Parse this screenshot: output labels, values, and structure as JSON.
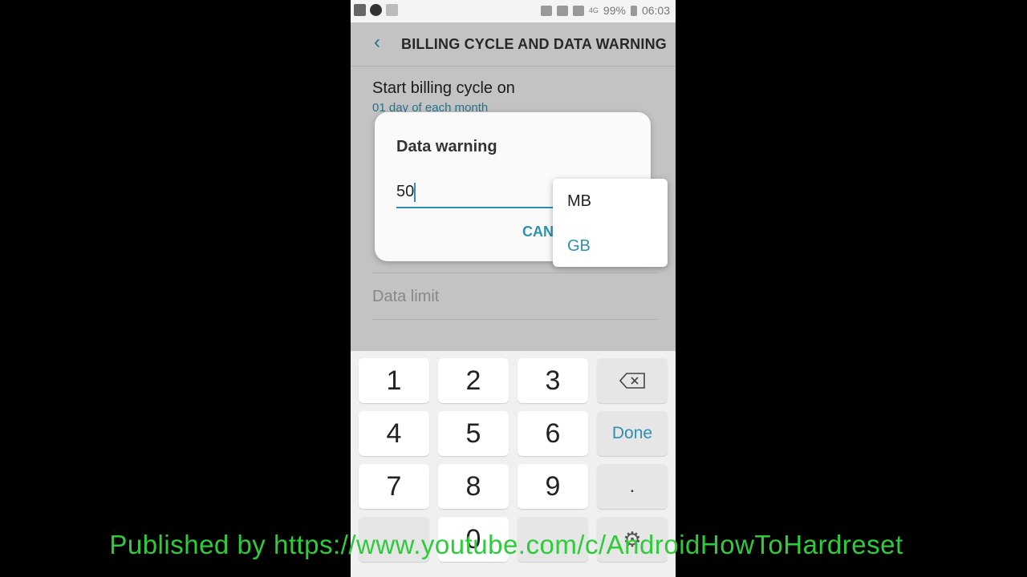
{
  "statusbar": {
    "battery": "99%",
    "time": "06:03",
    "network": "4G",
    "icons": [
      "gallery-icon",
      "app-icon",
      "notification-icon",
      "cast-icon",
      "sim-icon",
      "signal-icon",
      "battery-icon"
    ]
  },
  "appbar": {
    "title": "BILLING CYCLE AND DATA WARNING",
    "back_icon": "chevron-left-icon"
  },
  "settings": {
    "billing_cycle": {
      "title": "Start billing cycle on",
      "value": "01 day of each month"
    },
    "data_limit": {
      "title": "Data limit"
    }
  },
  "dialog": {
    "title": "Data warning",
    "input_value": "50",
    "cancel_label": "CANC"
  },
  "dropdown": {
    "options": [
      "MB",
      "GB"
    ],
    "selected": "GB"
  },
  "keyboard": {
    "keys": [
      "1",
      "2",
      "3",
      "4",
      "5",
      "6",
      "7",
      "8",
      "9",
      "0"
    ],
    "done_label": "Done",
    "dot_label": "."
  },
  "watermark": "Published by https://www.youtube.com/c/AndroidHowToHardreset",
  "colors": {
    "accent": "#2f8fb0",
    "watermark": "#2ecc3a"
  }
}
